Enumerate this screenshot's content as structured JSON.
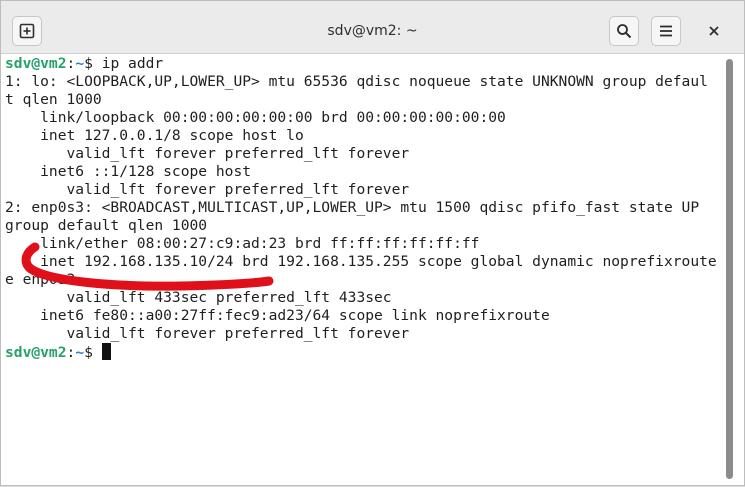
{
  "window": {
    "title": "sdv@vm2: ~",
    "icons": {
      "new_tab": "new-tab-icon",
      "search": "search-icon",
      "menu": "hamburger-menu-icon",
      "close": "close-icon"
    }
  },
  "prompt": {
    "user": "sdv@vm2",
    "sep": ":",
    "path": "~",
    "symbol": "$ "
  },
  "command": "ip addr",
  "output": [
    "1: lo: <LOOPBACK,UP,LOWER_UP> mtu 65536 qdisc noqueue state UNKNOWN group defaul",
    "t qlen 1000",
    "    link/loopback 00:00:00:00:00:00 brd 00:00:00:00:00:00",
    "    inet 127.0.0.1/8 scope host lo",
    "       valid_lft forever preferred_lft forever",
    "    inet6 ::1/128 scope host",
    "       valid_lft forever preferred_lft forever",
    "2: enp0s3: <BROADCAST,MULTICAST,UP,LOWER_UP> mtu 1500 qdisc pfifo_fast state UP",
    "group default qlen 1000",
    "    link/ether 08:00:27:c9:ad:23 brd ff:ff:ff:ff:ff:ff",
    "    inet 192.168.135.10/24 brd 192.168.135.255 scope global dynamic noprefixroute",
    "e enp0s3",
    "       valid_lft 433sec preferred_lft 433sec",
    "    inet6 fe80::a00:27ff:fec9:ad23/64 scope link noprefixroute",
    "       valid_lft forever preferred_lft forever"
  ],
  "colors": {
    "prompt_user": "#26a269",
    "prompt_path": "#2a7bde",
    "annotation_stroke": "#e0101a",
    "terminal_bg": "#ffffff",
    "titlebar_bg": "#ebebeb"
  }
}
